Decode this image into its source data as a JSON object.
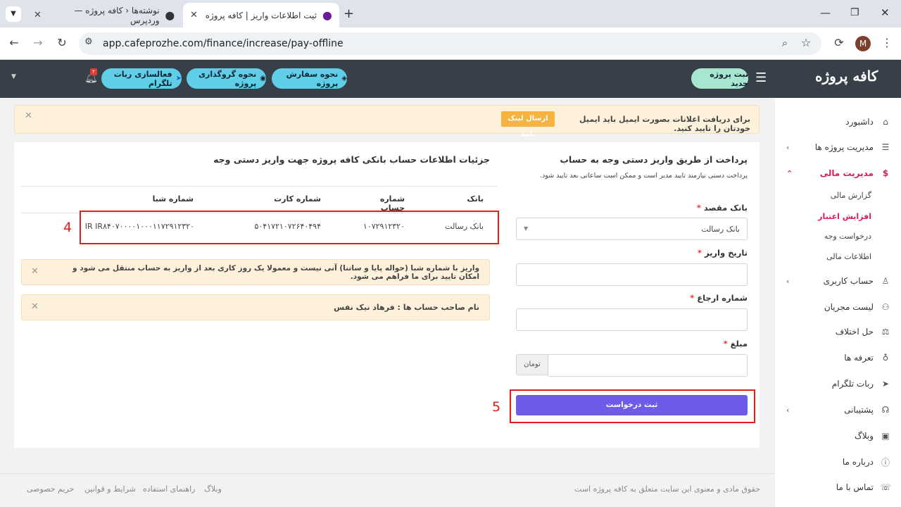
{
  "browser": {
    "tabs": [
      {
        "title": "ثبت اطلاعات واریز | کافه پروژه",
        "active": true
      },
      {
        "title": "نوشته‌ها ‹ کافه پروژه — وردپرس",
        "active": false
      }
    ],
    "url": "app.cafeprozhe.com/finance/increase/pay-offline",
    "profile_initial": "M",
    "new_tab": "+",
    "icons": [
      "back-icon",
      "forward-icon",
      "reload-icon",
      "site-info-icon",
      "zoom-icon",
      "star-icon",
      "extension-icon",
      "menu-icon",
      "minimize-icon",
      "maximize-icon",
      "close-icon"
    ]
  },
  "header": {
    "logo": "کافه پروژه",
    "new_project": "ثبت پروژه جدید",
    "order_guide": "نحوه سفارش پروژه",
    "deposit_guide": "نحوه گروگذاری پروژه",
    "telegram_bot": "فعالسازی ربات تلگرام",
    "notif_count": "۲"
  },
  "sidebar": {
    "items": [
      {
        "label": "داشبورد",
        "icon": "home-icon"
      },
      {
        "label": "مدیریت پروژه ها",
        "icon": "list-icon",
        "chevron": true
      },
      {
        "label": "مدیریت مالی",
        "icon": "dollar-icon",
        "chevron": true,
        "active": true
      },
      {
        "label": "حساب کاربری",
        "icon": "user-icon",
        "chevron": true
      },
      {
        "label": "لیست مجریان",
        "icon": "users-icon"
      },
      {
        "label": "حل اختلاف",
        "icon": "scale-icon"
      },
      {
        "label": "تعرفه ها",
        "icon": "tariff-icon"
      },
      {
        "label": "ربات تلگرام",
        "icon": "telegram-icon"
      },
      {
        "label": "پشتیبانی",
        "icon": "headset-icon",
        "chevron": true
      },
      {
        "label": "وبلاگ",
        "icon": "blog-icon"
      },
      {
        "label": "درباره ما",
        "icon": "info-icon"
      },
      {
        "label": "تماس با ما",
        "icon": "phone-icon"
      }
    ],
    "finance_sub": [
      "گزارش مالی",
      "افزایش اعتبار",
      "درخواست وجه",
      "اطلاعات مالی"
    ],
    "active_color": "#d81b60"
  },
  "alert": {
    "text": "برای دریافت اعلانات بصورت ایمیل باید ایمیل خودتان را تایید کنید.",
    "button": "ارسال لینک تایید",
    "close": "✕"
  },
  "form": {
    "title": "پرداخت از طریق واریز دستی وجه به حساب",
    "subtitle": "پرداخت دستی نیازمند تایید مدیر است و ممکن است ساعاتی بعد تایید شود.",
    "bank_label": "بانک مقصد",
    "bank_value": "بانک رسالت",
    "date_label": "تاریخ واریز",
    "ref_label": "شماره ارجاع",
    "amount_label": "مبلغ",
    "currency": "تومان",
    "required_mark": "*",
    "submit": "ثبت درخواست",
    "submit_color": "#6c5ce7"
  },
  "details": {
    "title": "جزئیات اطلاعات حساب بانکی کافه پروژه جهت واریز دستی وجه",
    "columns": [
      "بانک",
      "شماره حساب",
      "شماره کارت",
      "شماره شبا"
    ],
    "row": [
      "بانک رسالت",
      "۱۰۷۲۹۱۲۳۲۰",
      "۵۰۴۱۷۲۱۰۷۲۶۴۰۴۹۴",
      "IR IR۸۴۰۷۰۰۰۰۱۰۰۰۱۱۷۲۹۱۲۳۲۰"
    ],
    "note1": "واریز با شماره شبا (حواله پایا و ساتنا) آنی نیست و معمولا یک روز کاری بعد از واریز به حساب منتقل می شود و امکان تایید برای ما فراهم می شود.",
    "note2": "نام صاحب حساب ها : فرهاد نیک نفس"
  },
  "annotations": {
    "box4": "4",
    "box5": "5",
    "color": "#e41c1c"
  },
  "footer": {
    "copyright": "حقوق مادی و معنوی این سایت متعلق به کافه پروژه است",
    "links": [
      "وبلاگ",
      "راهنمای استفاده",
      "شرایط و قوانین",
      "حریم خصوصی"
    ]
  }
}
